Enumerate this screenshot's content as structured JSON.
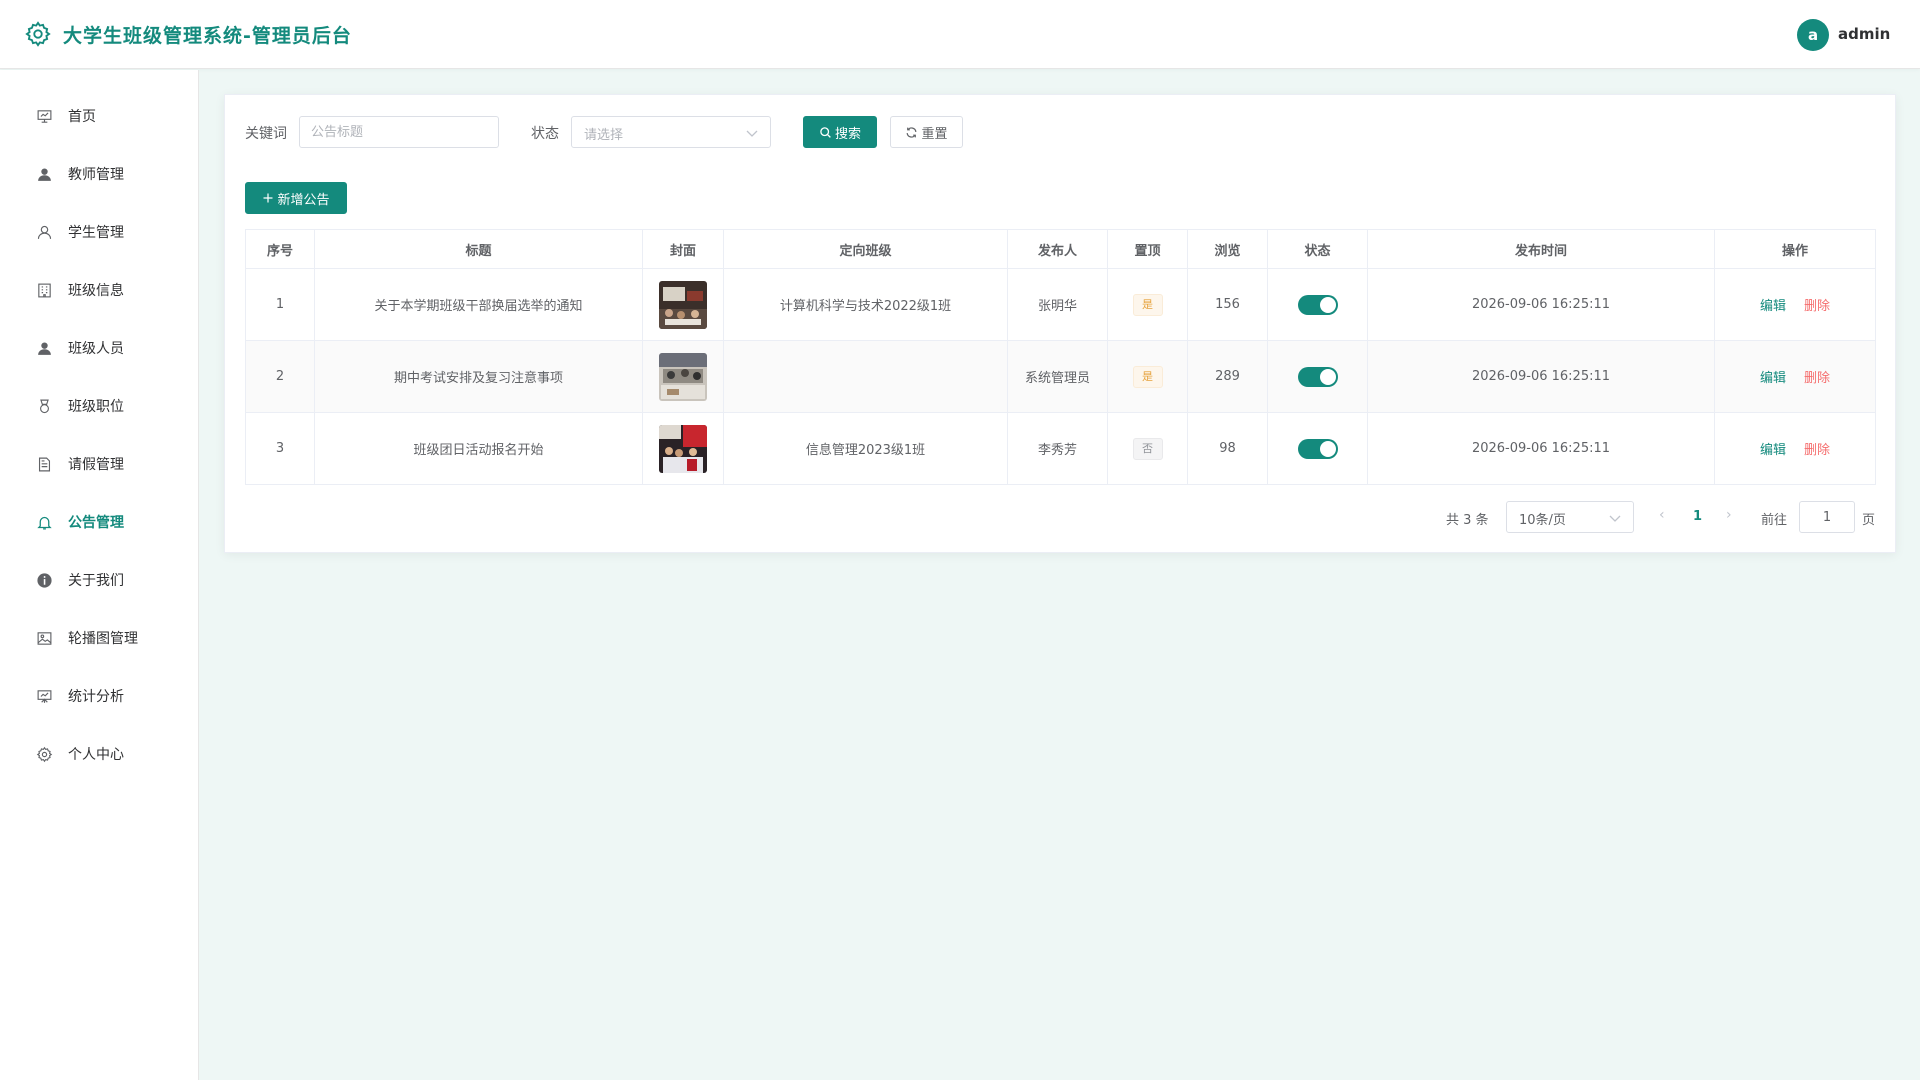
{
  "header": {
    "title": "大学生班级管理系统-管理员后台",
    "user_initial": "a",
    "user_name": "admin"
  },
  "sidebar": {
    "items": [
      {
        "label": "首页",
        "icon": "dashboard-icon"
      },
      {
        "label": "教师管理",
        "icon": "user-filled-icon"
      },
      {
        "label": "学生管理",
        "icon": "user-outline-icon"
      },
      {
        "label": "班级信息",
        "icon": "building-icon"
      },
      {
        "label": "班级人员",
        "icon": "user-filled-icon"
      },
      {
        "label": "班级职位",
        "icon": "medal-icon"
      },
      {
        "label": "请假管理",
        "icon": "document-icon"
      },
      {
        "label": "公告管理",
        "icon": "bell-icon",
        "active": true
      },
      {
        "label": "关于我们",
        "icon": "info-icon"
      },
      {
        "label": "轮播图管理",
        "icon": "picture-icon"
      },
      {
        "label": "统计分析",
        "icon": "presentation-icon"
      },
      {
        "label": "个人中心",
        "icon": "gear-icon"
      }
    ]
  },
  "filters": {
    "keyword_label": "关键词",
    "keyword_value": "",
    "keyword_placeholder": "公告标题",
    "status_label": "状态",
    "status_placeholder": "请选择",
    "search_label": "搜索",
    "reset_label": "重置"
  },
  "add_button_label": "新增公告",
  "table": {
    "columns": [
      "序号",
      "标题",
      "封面",
      "定向班级",
      "发布人",
      "置顶",
      "浏览",
      "状态",
      "发布时间",
      "操作"
    ],
    "rows": [
      {
        "index": "1",
        "title": "关于本学期班级干部换届选举的通知",
        "cover": "cover-photo-1",
        "target_class": "计算机科学与技术2022级1班",
        "publisher": "张明华",
        "pinned": "是",
        "views": "156",
        "status": true,
        "time": "2026-09-06 16:25:11",
        "edit": "编辑",
        "delete": "删除"
      },
      {
        "index": "2",
        "title": "期中考试安排及复习注意事项",
        "cover": "cover-photo-2",
        "target_class": "",
        "publisher": "系统管理员",
        "pinned": "是",
        "views": "289",
        "status": true,
        "time": "2026-09-06 16:25:11",
        "edit": "编辑",
        "delete": "删除"
      },
      {
        "index": "3",
        "title": "班级团日活动报名开始",
        "cover": "cover-photo-3",
        "target_class": "信息管理2023级1班",
        "publisher": "李秀芳",
        "pinned": "否",
        "views": "98",
        "status": true,
        "time": "2026-09-06 16:25:11",
        "edit": "编辑",
        "delete": "删除"
      }
    ]
  },
  "pagination": {
    "total_text": "共 3 条",
    "page_size": "10条/页",
    "current_page": "1",
    "goto_label": "前往",
    "goto_value": "1",
    "page_suffix": "页"
  },
  "colors": {
    "primary": "#148a7d",
    "danger": "#f56c6c",
    "warning": "#e6a23c",
    "background": "#eef7f5"
  }
}
